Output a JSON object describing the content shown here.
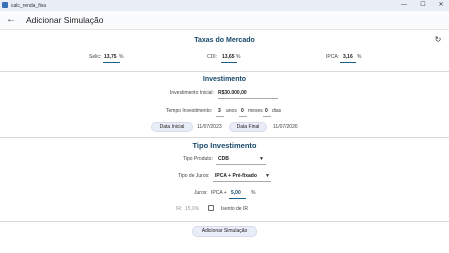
{
  "window": {
    "title": "calc_renda_fixa",
    "minimize": "—",
    "maximize": "☐",
    "close": "✕"
  },
  "header": {
    "title": "Adicionar Simulação",
    "back_icon": "←"
  },
  "taxas": {
    "title": "Taxas do Mercado",
    "refresh_icon": "↻",
    "selic": {
      "label": "Selic:",
      "value": "13,75",
      "unit": "%"
    },
    "cdi": {
      "label": "CDI:",
      "value": "13,65",
      "unit": "%"
    },
    "ipca": {
      "label": "IPCA:",
      "value": "3,16",
      "unit": "%"
    }
  },
  "investimento": {
    "title": "Investimento",
    "valor_label": "Investimento Inicial:",
    "valor_value": "R$30.000,00",
    "tempo_label": "Tempo Investimento:",
    "anos_value": "3",
    "anos_label": "anos",
    "meses_value": "0",
    "meses_label": "meses",
    "dias_value": "0",
    "dias_label": "dias",
    "data_inicial_button": "Data Inicial",
    "data_inicial_value": "11/07/2023",
    "data_final_button": "Data Final",
    "data_final_value": "11/07/2026"
  },
  "tipo": {
    "title": "Tipo Investimento",
    "produto_label": "Tipo Produto:",
    "produto_value": "CDB",
    "juros_tipo_label": "Tipo de Juros:",
    "juros_tipo_value": "IPCA + Pré-fixado",
    "juros_label": "Juros:",
    "juros_prefix": "IPCA +",
    "juros_value": "5,00",
    "juros_unit": "%",
    "ir_label": "IR:",
    "ir_value": "15,0%",
    "isento_label": "Isento de IR",
    "dropdown_icon": "▼"
  },
  "actions": {
    "add_button": "Adicionar Simulação"
  }
}
